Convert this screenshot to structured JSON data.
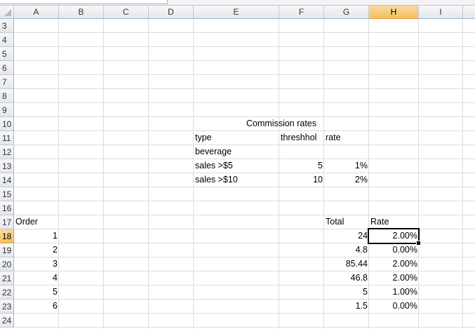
{
  "columns": [
    "A",
    "B",
    "C",
    "D",
    "E",
    "F",
    "G",
    "H",
    "I",
    ""
  ],
  "rows": [
    "3",
    "4",
    "5",
    "6",
    "7",
    "8",
    "9",
    "10",
    "11",
    "12",
    "13",
    "14",
    "15",
    "16",
    "17",
    "18",
    "19",
    "20",
    "21",
    "22",
    "23",
    "24"
  ],
  "selected": {
    "column": "H",
    "row": "18"
  },
  "cells": [
    {
      "ref": "E10",
      "span": "E:G",
      "value": "Commission rates",
      "type": "center"
    },
    {
      "ref": "E11",
      "value": "type",
      "type": "text"
    },
    {
      "ref": "F11",
      "value": "threshhol",
      "type": "text"
    },
    {
      "ref": "G11",
      "value": "rate",
      "type": "text"
    },
    {
      "ref": "E12",
      "value": "beverage",
      "type": "text"
    },
    {
      "ref": "E13",
      "value": "sales >$5",
      "type": "text"
    },
    {
      "ref": "F13",
      "value": "5",
      "type": "num"
    },
    {
      "ref": "G13",
      "value": "1%",
      "type": "num"
    },
    {
      "ref": "E14",
      "value": "sales >$10",
      "type": "text"
    },
    {
      "ref": "F14",
      "value": "10",
      "type": "num"
    },
    {
      "ref": "G14",
      "value": "2%",
      "type": "num"
    },
    {
      "ref": "A17",
      "value": "Order",
      "type": "text"
    },
    {
      "ref": "G17",
      "value": "Total",
      "type": "text"
    },
    {
      "ref": "H17",
      "value": "Rate",
      "type": "text"
    },
    {
      "ref": "A18",
      "value": "1",
      "type": "num"
    },
    {
      "ref": "G18",
      "value": "24",
      "type": "num"
    },
    {
      "ref": "H18",
      "value": "2.00%",
      "type": "num"
    },
    {
      "ref": "A19",
      "value": "2",
      "type": "num"
    },
    {
      "ref": "G19",
      "value": "4.8",
      "type": "num"
    },
    {
      "ref": "H19",
      "value": "0.00%",
      "type": "num"
    },
    {
      "ref": "A20",
      "value": "3",
      "type": "num"
    },
    {
      "ref": "G20",
      "value": "85.44",
      "type": "num"
    },
    {
      "ref": "H20",
      "value": "2.00%",
      "type": "num"
    },
    {
      "ref": "A21",
      "value": "4",
      "type": "num"
    },
    {
      "ref": "G21",
      "value": "46.8",
      "type": "num"
    },
    {
      "ref": "H21",
      "value": "2.00%",
      "type": "num"
    },
    {
      "ref": "A22",
      "value": "5",
      "type": "num"
    },
    {
      "ref": "G22",
      "value": "5",
      "type": "num"
    },
    {
      "ref": "H22",
      "value": "1.00%",
      "type": "num"
    },
    {
      "ref": "A23",
      "value": "6",
      "type": "num"
    },
    {
      "ref": "G23",
      "value": "1.5",
      "type": "num"
    },
    {
      "ref": "H23",
      "value": "0.00%",
      "type": "num"
    }
  ]
}
